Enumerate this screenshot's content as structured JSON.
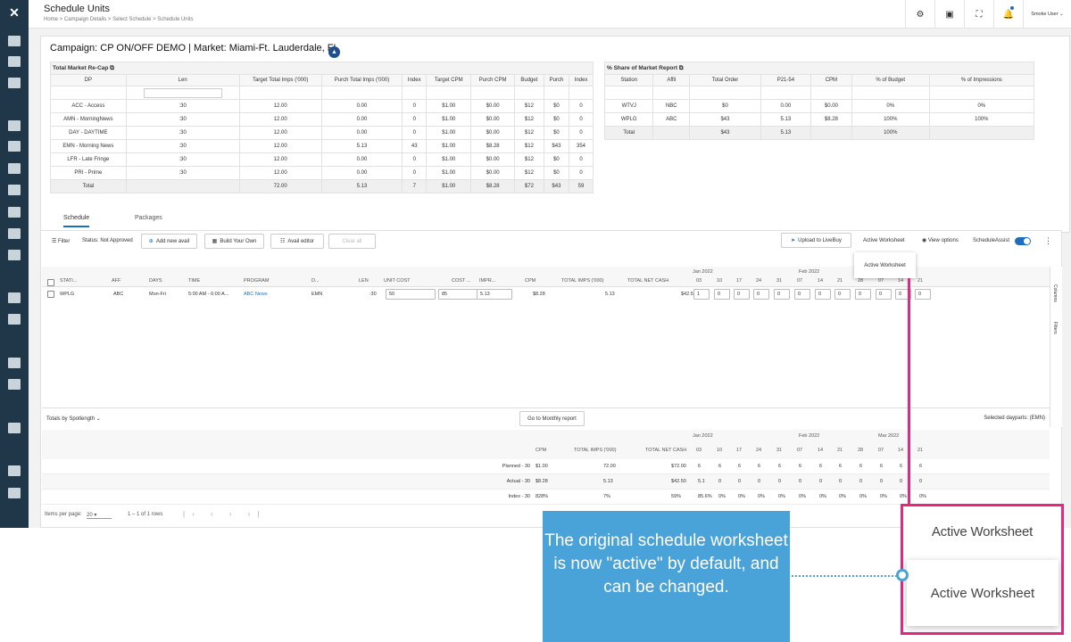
{
  "header": {
    "title": "Schedule Units",
    "breadcrumbs": [
      "Home",
      "Campaign Details",
      "Select Schedule",
      "Schedule Units"
    ],
    "user": "Smoke User"
  },
  "campaign": {
    "title": "Campaign: CP ON/OFF DEMO | Market: Miami-Ft. Lauderdale, FL"
  },
  "recap": {
    "title": "Total Market Re-Cap",
    "columns": [
      "DP",
      "Len",
      "Target Total Imps ('000)",
      "Purch Total Imps ('000)",
      "Index",
      "Target CPM",
      "Purch CPM",
      "Budget",
      "Purch",
      "Index"
    ],
    "rows": [
      [
        "ACC - Access",
        ":30",
        "12.00",
        "0.00",
        "0",
        "$1.00",
        "$0.00",
        "$12",
        "$0",
        "0"
      ],
      [
        "AMN - MorningNews",
        ":30",
        "12.00",
        "0.00",
        "0",
        "$1.00",
        "$0.00",
        "$12",
        "$0",
        "0"
      ],
      [
        "DAY - DAYTIME",
        ":30",
        "12.00",
        "0.00",
        "0",
        "$1.00",
        "$0.00",
        "$12",
        "$0",
        "0"
      ],
      [
        "EMN - Morning News",
        ":30",
        "12.00",
        "5.13",
        "43",
        "$1.00",
        "$8.28",
        "$12",
        "$43",
        "354"
      ],
      [
        "LFR - Late Fringe",
        ":30",
        "12.00",
        "0.00",
        "0",
        "$1.00",
        "$0.00",
        "$12",
        "$0",
        "0"
      ],
      [
        "PRI - Prime",
        ":30",
        "12.00",
        "0.00",
        "0",
        "$1.00",
        "$0.00",
        "$12",
        "$0",
        "0"
      ],
      [
        "Total",
        "",
        "72.00",
        "5.13",
        "7",
        "$1.00",
        "$8.28",
        "$72",
        "$43",
        "59"
      ]
    ]
  },
  "share": {
    "title": "% Share of Market Report",
    "columns": [
      "Station",
      "Affil",
      "Total Order",
      "P21-54",
      "CPM",
      "% of Budget",
      "% of Impressions"
    ],
    "rows": [
      [
        "WTVJ",
        "NBC",
        "$0",
        "0.00",
        "$0.00",
        "0%",
        "0%"
      ],
      [
        "WPLG",
        "ABC",
        "$43",
        "5.13",
        "$8.28",
        "100%",
        "100%"
      ],
      [
        "Total",
        "",
        "$43",
        "5.13",
        "",
        "100%",
        ""
      ]
    ]
  },
  "tabs": [
    "Schedule",
    "Packages"
  ],
  "toolbar": {
    "filter": "Filter",
    "status": "Status: Not Approved",
    "add_avail": "Add new avail",
    "build": "Build Your Own",
    "avail_editor": "Avail editor",
    "clear_all": "Clear all",
    "upload": "Upload to LiveBuy",
    "active_ws": "Active Worksheet",
    "view_options": "View options",
    "schedule_assist": "ScheduleAssist"
  },
  "grid": {
    "month_jan": "Jan 2022",
    "month_feb": "Feb 2022",
    "headers": [
      "STATI...",
      "AFF",
      "DAYS",
      "TIME",
      "PROGRAM",
      "D...",
      "LEN",
      "UNIT COST",
      "COST ...",
      "IMPR...",
      "CPM",
      "TOTAL IMPS ('000)",
      "TOTAL NET CASH"
    ],
    "weeks": [
      "03",
      "10",
      "17",
      "24",
      "31",
      "07",
      "14",
      "21",
      "28",
      "07",
      "14",
      "21"
    ],
    "row": {
      "station": "WPLG",
      "aff": "ABC",
      "days": "Mon-Fri",
      "time": "5:00 AM - 6:00 A...",
      "program": "ABC News",
      "dp": "EMN",
      "len": ":30",
      "unit_cost": "50",
      "cost": "85",
      "impr": "5.13",
      "cpm": "$8.28",
      "total_imps": "5.13",
      "net_cash": "$42.50",
      "weeks": [
        "1",
        "0",
        "0",
        "0",
        "0",
        "0",
        "0",
        "0",
        "0",
        "0",
        "0",
        "0"
      ]
    },
    "side": [
      "Columns",
      "Filters"
    ]
  },
  "dropdown": {
    "item": "Active Worksheet"
  },
  "totals": {
    "label": "Totals by Spotlength",
    "monthly_btn": "Go to Monthly report",
    "selected": "Selected dayparts: (EMN)",
    "months": [
      "Jan 2022",
      "Feb 2022",
      "Mar 2022"
    ],
    "cols": [
      "CPM",
      "TOTAL IMPS ('000)",
      "TOTAL NET CASH"
    ],
    "weeks": [
      "03",
      "10",
      "17",
      "24",
      "31",
      "07",
      "14",
      "21",
      "28",
      "07",
      "14",
      "21"
    ],
    "rows": [
      {
        "label": "Planned - 30",
        "cpm": "$1.00",
        "imps": "72.00",
        "cash": "$72.00",
        "w": [
          "6",
          "6",
          "6",
          "6",
          "6",
          "6",
          "6",
          "6",
          "6",
          "6",
          "6",
          "6"
        ]
      },
      {
        "label": "Actual - 30",
        "cpm": "$8.28",
        "imps": "5.13",
        "cash": "$42.50",
        "w": [
          "5.1",
          "0",
          "0",
          "0",
          "0",
          "0",
          "0",
          "0",
          "0",
          "0",
          "0",
          "0"
        ]
      },
      {
        "label": "Index - 30",
        "cpm": "828%",
        "imps": "7%",
        "cash": "59%",
        "w": [
          "85.6%",
          "0%",
          "0%",
          "0%",
          "0%",
          "0%",
          "0%",
          "0%",
          "0%",
          "0%",
          "0%",
          "0%"
        ]
      }
    ]
  },
  "pager": {
    "items_label": "Items per page:",
    "items": "20",
    "range": "1 – 1 of 1 rows"
  },
  "callout": {
    "text": "The original schedule worksheet is now \"active\" by default, and can be changed."
  },
  "zoom": {
    "label1": "Active Worksheet",
    "label2": "Active Worksheet"
  }
}
